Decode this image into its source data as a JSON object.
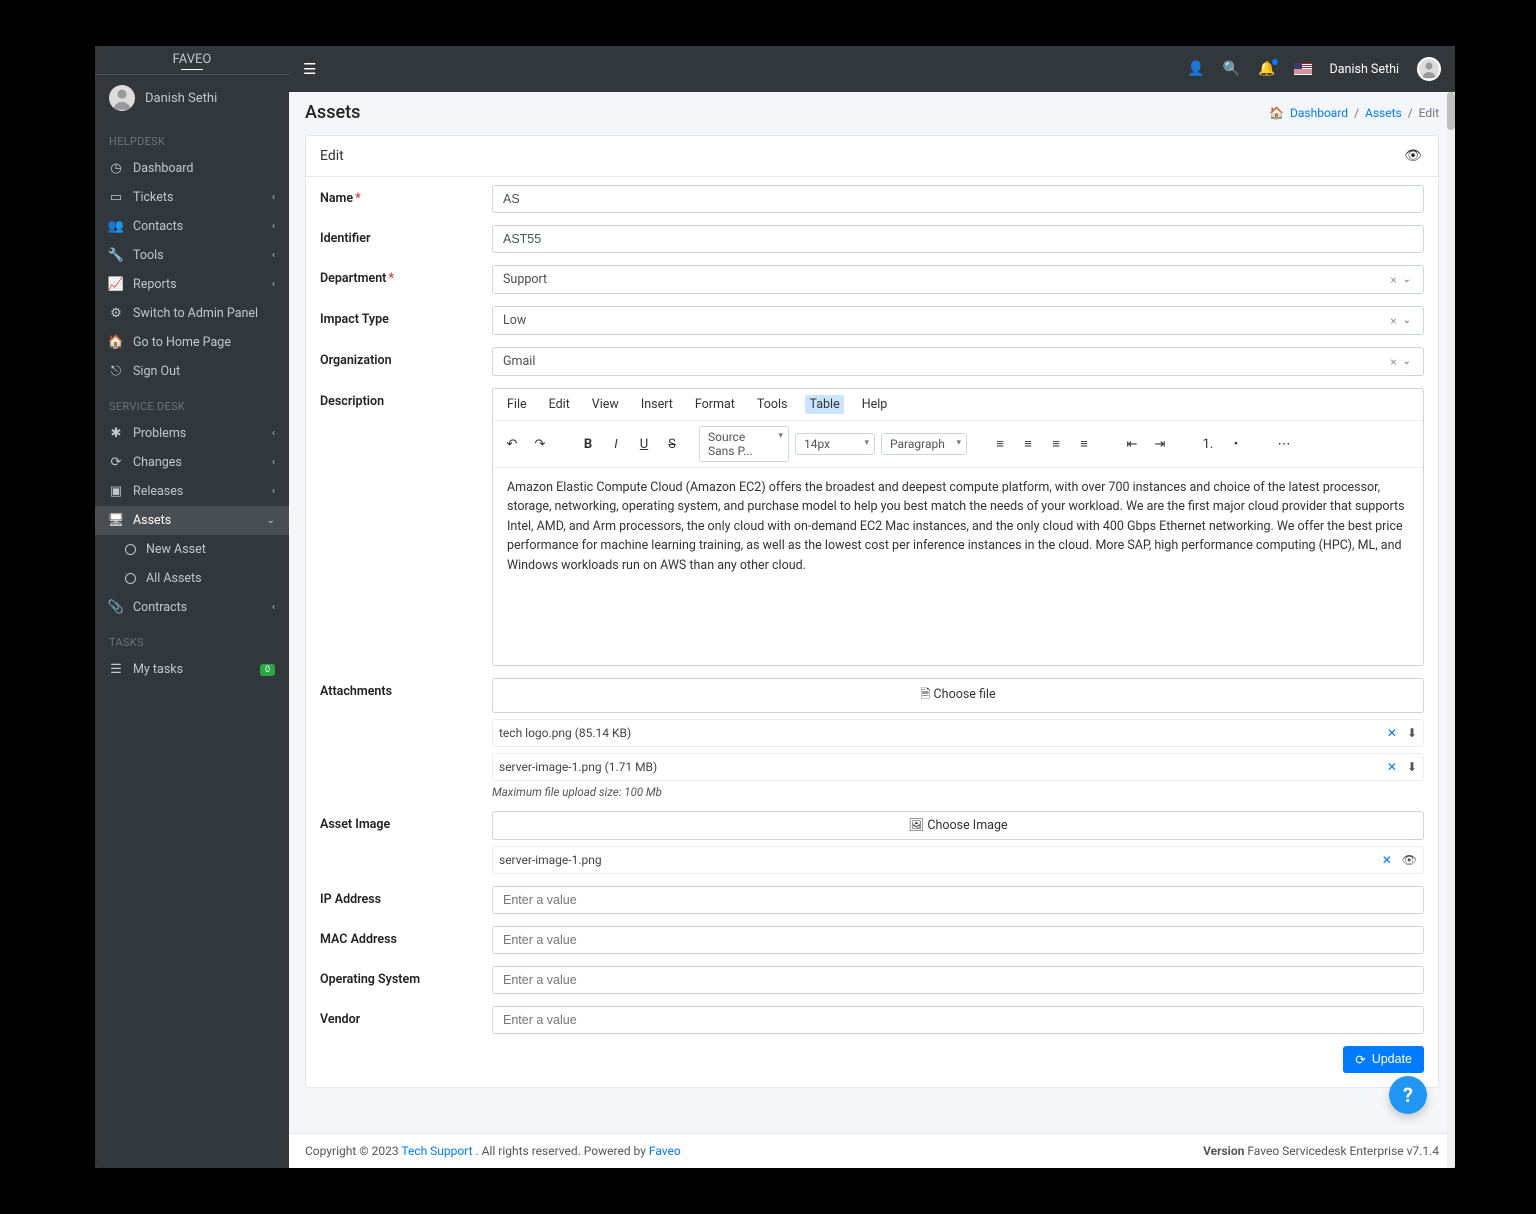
{
  "brand": "FAVEO",
  "user": {
    "name": "Danish Sethi"
  },
  "header": {
    "name": "Danish Sethi"
  },
  "sidebar": {
    "sections": {
      "helpdesk": {
        "label": "HELPDESK",
        "items": [
          {
            "label": "Dashboard"
          },
          {
            "label": "Tickets"
          },
          {
            "label": "Contacts"
          },
          {
            "label": "Tools"
          },
          {
            "label": "Reports"
          },
          {
            "label": "Switch to Admin Panel"
          },
          {
            "label": "Go to Home Page"
          },
          {
            "label": "Sign Out"
          }
        ]
      },
      "servicedesk": {
        "label": "SERVICE DESK",
        "items": [
          {
            "label": "Problems"
          },
          {
            "label": "Changes"
          },
          {
            "label": "Releases"
          },
          {
            "label": "Assets"
          },
          {
            "label": "New Asset"
          },
          {
            "label": "All Assets"
          },
          {
            "label": "Contracts"
          }
        ]
      },
      "tasks": {
        "label": "TASKS",
        "mytasks": {
          "label": "My tasks",
          "count": "0"
        }
      }
    }
  },
  "breadcrumb": {
    "dashboard": "Dashboard",
    "assets": "Assets",
    "edit": "Edit"
  },
  "page": {
    "title": "Assets",
    "card_title": "Edit"
  },
  "form": {
    "labels": {
      "name": "Name",
      "identifier": "Identifier",
      "department": "Department",
      "impact": "Impact Type",
      "organization": "Organization",
      "description": "Description",
      "attachments": "Attachments",
      "asset_image": "Asset Image",
      "ip": "IP Address",
      "mac": "MAC Address",
      "os": "Operating System",
      "vendor": "Vendor"
    },
    "values": {
      "name": "AS",
      "identifier": "AST55",
      "department": "Support",
      "impact": "Low",
      "organization": "Gmail",
      "ip": "",
      "mac": "",
      "os": "",
      "vendor": ""
    },
    "placeholders": {
      "generic": "Enter a value"
    },
    "description_text": "Amazon Elastic Compute Cloud (Amazon EC2) offers the broadest and deepest compute platform, with over 700 instances and choice of the latest processor, storage, networking, operating system, and purchase model to help you best match the needs of your workload. We are the first major cloud provider that supports Intel, AMD, and Arm processors, the only cloud with on-demand EC2 Mac instances, and the only cloud with 400 Gbps Ethernet networking. We offer the best price performance for machine learning training, as well as the lowest cost per inference instances in the cloud. More SAP, high performance computing (HPC), ML, and Windows workloads run on AWS than any other cloud."
  },
  "editor": {
    "menu": {
      "file": "File",
      "edit": "Edit",
      "view": "View",
      "insert": "Insert",
      "format": "Format",
      "tools": "Tools",
      "table": "Table",
      "help": "Help"
    },
    "font": "Source Sans P...",
    "size": "14px",
    "block": "Paragraph"
  },
  "attachments": {
    "choose_label": "Choose file",
    "max_hint": "Maximum file upload size: 100 Mb",
    "files": [
      {
        "name": "tech logo.png (85.14 KB)"
      },
      {
        "name": "server-image-1.png (1.71 MB)"
      }
    ]
  },
  "asset_image": {
    "choose_label": "Choose Image",
    "file": "server-image-1.png"
  },
  "buttons": {
    "update": "Update"
  },
  "footer": {
    "copyright": "Copyright © 2023 ",
    "tech": "Tech Support",
    "rights": ".  All rights reserved. Powered by ",
    "faveo": "Faveo",
    "version_label": "Version",
    "version_text": " Faveo Servicedesk Enterprise v7.1.4"
  }
}
